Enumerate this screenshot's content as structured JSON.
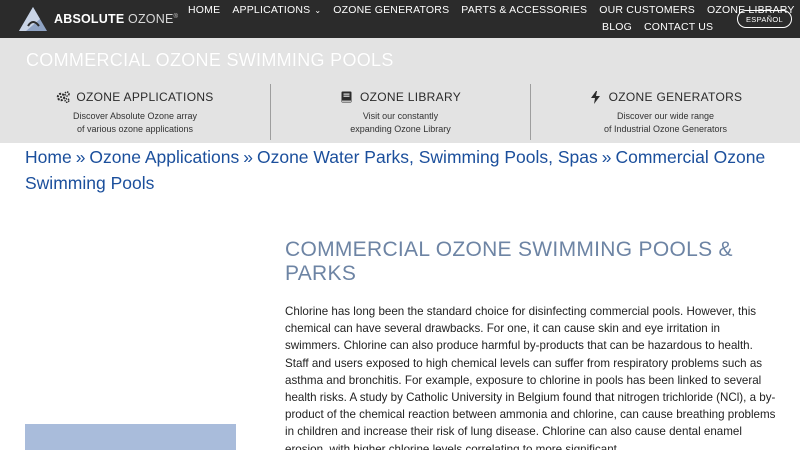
{
  "header": {
    "logo": {
      "brand_strong": "ABSOLUTE",
      "brand_light": "OZONE",
      "mark": "®"
    },
    "nav_row1": [
      {
        "label": "HOME",
        "dropdown": false
      },
      {
        "label": "APPLICATIONS",
        "dropdown": true
      },
      {
        "label": "OZONE GENERATORS",
        "dropdown": false
      },
      {
        "label": "PARTS & ACCESSORIES",
        "dropdown": false
      },
      {
        "label": "OUR CUSTOMERS",
        "dropdown": false
      },
      {
        "label": "OZONE LIBRARY",
        "dropdown": false
      }
    ],
    "nav_row2": [
      {
        "label": "BLOG"
      },
      {
        "label": "CONTACT US"
      }
    ],
    "language_button": "ESPAÑOL"
  },
  "hero": {
    "title": "COMMERCIAL OZONE SWIMMING POOLS",
    "features": [
      {
        "icon": "gears-icon",
        "title": "OZONE APPLICATIONS",
        "line1": "Discover Absolute Ozone array",
        "line2": "of various ozone applications"
      },
      {
        "icon": "book-icon",
        "title": "OZONE LIBRARY",
        "line1": "Visit our constantly",
        "line2": "expanding Ozone Library"
      },
      {
        "icon": "bolt-icon",
        "title": "OZONE GENERATORS",
        "line1": "Discover our wide range",
        "line2": "of Industrial Ozone Generators"
      }
    ]
  },
  "breadcrumb": {
    "items": [
      "Home",
      "Ozone Applications",
      "Ozone Water Parks, Swimming Pools, Spas",
      "Commercial Ozone Swimming Pools"
    ],
    "separator": "»"
  },
  "content": {
    "title": "COMMERCIAL OZONE SWIMMING POOLS & PARKS",
    "body": "Chlorine has long been the standard choice for disinfecting commercial pools. However, this chemical can have several drawbacks. For one, it can cause skin and eye irritation in swimmers. Chlorine can also produce harmful by-products that can be hazardous to health. Staff and users exposed to high chemical levels can suffer from respiratory problems such as asthma and bronchitis. For example, exposure to chlorine in pools has been linked to several health risks. A study by Catholic University in Belgium found that nitrogen trichloride (NCl), a by-product of the chemical reaction between ammonia and chlorine, can cause breathing problems in children and increase their risk of lung disease. Chlorine can also cause dental enamel erosion, with higher chlorine levels correlating to more significant"
  },
  "colors": {
    "topbar": "#2b2b2b",
    "hero_bg": "#e3e3e3",
    "link_blue": "#1b4f9c",
    "heading_blue": "#6d84a4",
    "image_placeholder": "#a9bcdb"
  }
}
